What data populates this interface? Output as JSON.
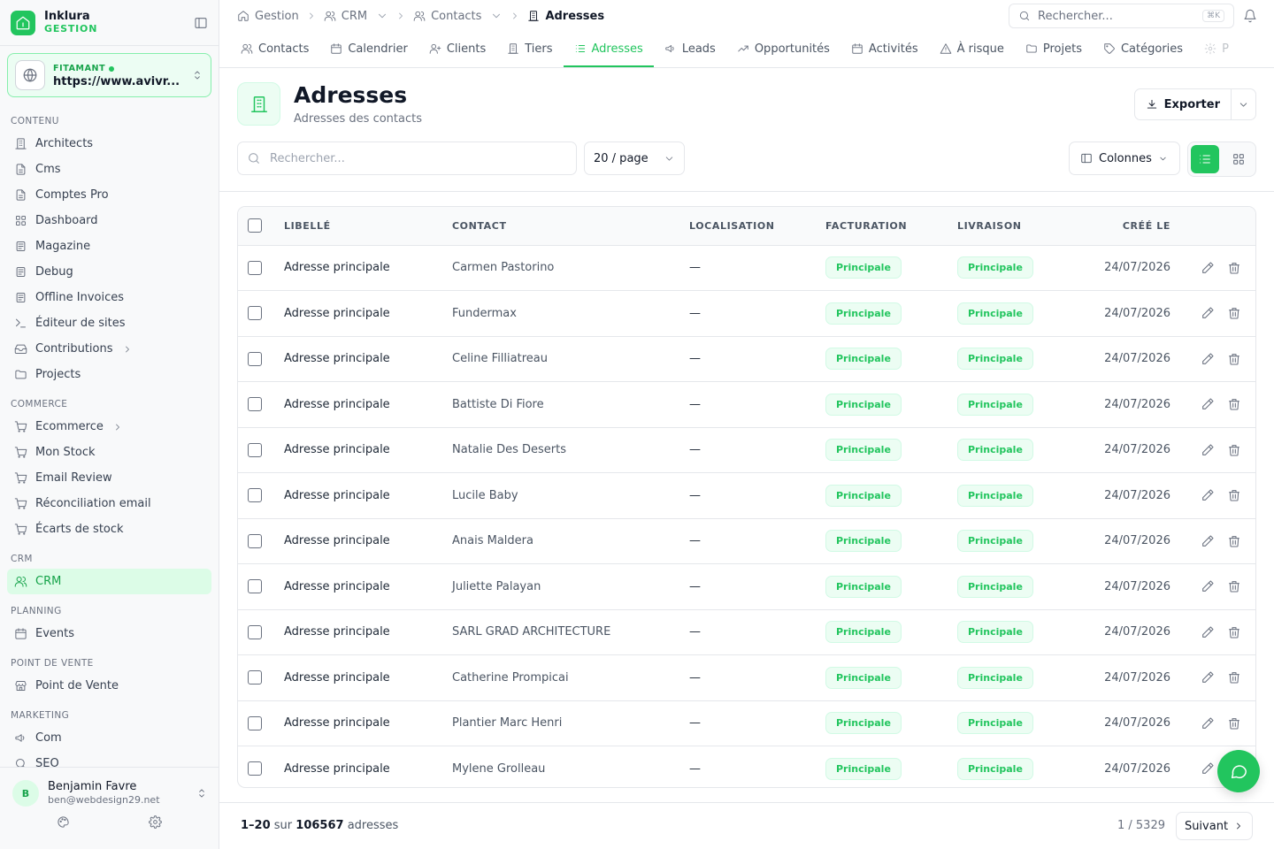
{
  "brand": {
    "name": "Inklura",
    "sub": "GESTION"
  },
  "site": {
    "label": "FITAMANT",
    "url": "https://www.avivr..."
  },
  "sidebar": {
    "sections": [
      {
        "title": "CONTENU",
        "items": [
          {
            "label": "Architects",
            "icon": "building-icon"
          },
          {
            "label": "Cms",
            "icon": "file-icon"
          },
          {
            "label": "Comptes Pro",
            "icon": "file-icon"
          },
          {
            "label": "Dashboard",
            "icon": "grid-icon"
          },
          {
            "label": "Magazine",
            "icon": "newspaper-icon"
          },
          {
            "label": "Debug",
            "icon": "newspaper-icon"
          },
          {
            "label": "Offline Invoices",
            "icon": "newspaper-icon"
          },
          {
            "label": "Éditeur de sites",
            "icon": "terminal-icon"
          },
          {
            "label": "Contributions",
            "icon": "inbox-icon",
            "chevron": true
          },
          {
            "label": "Projects",
            "icon": "folder-icon"
          }
        ]
      },
      {
        "title": "COMMERCE",
        "items": [
          {
            "label": "Ecommerce",
            "icon": "cart-icon",
            "chevron": true
          },
          {
            "label": "Mon Stock",
            "icon": "cart-icon"
          },
          {
            "label": "Email Review",
            "icon": "cart-icon"
          },
          {
            "label": "Réconciliation email",
            "icon": "cart-icon"
          },
          {
            "label": "Écarts de stock",
            "icon": "cart-icon"
          }
        ]
      },
      {
        "title": "CRM",
        "items": [
          {
            "label": "CRM",
            "icon": "users-icon",
            "active": true
          }
        ]
      },
      {
        "title": "PLANNING",
        "items": [
          {
            "label": "Events",
            "icon": "calendar-icon"
          }
        ]
      },
      {
        "title": "POINT DE VENTE",
        "items": [
          {
            "label": "Point de Vente",
            "icon": "store-icon"
          }
        ]
      },
      {
        "title": "MARKETING",
        "items": [
          {
            "label": "Com",
            "icon": "megaphone-icon"
          },
          {
            "label": "SEO",
            "icon": "search-icon"
          }
        ]
      }
    ]
  },
  "user": {
    "initial": "B",
    "name": "Benjamin Favre",
    "email": "ben@webdesign29.net"
  },
  "breadcrumb": [
    {
      "label": "Gestion",
      "icon": "home-icon"
    },
    {
      "label": "CRM",
      "icon": "users-icon",
      "dropdown": true
    },
    {
      "label": "Contacts",
      "icon": "users-icon",
      "dropdown": true
    },
    {
      "label": "Adresses",
      "icon": "building-icon",
      "current": true
    }
  ],
  "topsearch": {
    "placeholder": "Rechercher...",
    "shortcut": "⌘K"
  },
  "tabs": [
    {
      "label": "Contacts",
      "icon": "users-icon"
    },
    {
      "label": "Calendrier",
      "icon": "calendar-icon"
    },
    {
      "label": "Clients",
      "icon": "user-plus-icon"
    },
    {
      "label": "Tiers",
      "icon": "building-icon"
    },
    {
      "label": "Adresses",
      "icon": "list-icon",
      "active": true
    },
    {
      "label": "Leads",
      "icon": "megaphone-icon"
    },
    {
      "label": "Opportunités",
      "icon": "trend-icon"
    },
    {
      "label": "Activités",
      "icon": "calendar-icon"
    },
    {
      "label": "À risque",
      "icon": "alert-icon"
    },
    {
      "label": "Projets",
      "icon": "folder-icon"
    },
    {
      "label": "Catégories",
      "icon": "tag-icon"
    },
    {
      "label": "P",
      "icon": "gear-icon"
    }
  ],
  "page": {
    "title": "Adresses",
    "subtitle": "Adresses des contacts",
    "export_label": "Exporter"
  },
  "filters": {
    "search_placeholder": "Rechercher...",
    "per_page": "20 / page",
    "columns_label": "Colonnes"
  },
  "table": {
    "headers": {
      "libelle": "LIBELLÉ",
      "contact": "CONTACT",
      "localisation": "LOCALISATION",
      "facturation": "FACTURATION",
      "livraison": "LIVRAISON",
      "cree_le": "CRÉÉ LE"
    },
    "rows": [
      {
        "libelle": "Adresse principale",
        "contact": "Carmen Pastorino",
        "localisation": "—",
        "facturation": "Principale",
        "livraison": "Principale",
        "date": "24/07/2026"
      },
      {
        "libelle": "Adresse principale",
        "contact": "Fundermax",
        "localisation": "—",
        "facturation": "Principale",
        "livraison": "Principale",
        "date": "24/07/2026"
      },
      {
        "libelle": "Adresse principale",
        "contact": "Celine Filliatreau",
        "localisation": "—",
        "facturation": "Principale",
        "livraison": "Principale",
        "date": "24/07/2026"
      },
      {
        "libelle": "Adresse principale",
        "contact": "Battiste Di Fiore",
        "localisation": "—",
        "facturation": "Principale",
        "livraison": "Principale",
        "date": "24/07/2026"
      },
      {
        "libelle": "Adresse principale",
        "contact": "Natalie Des Deserts",
        "localisation": "—",
        "facturation": "Principale",
        "livraison": "Principale",
        "date": "24/07/2026"
      },
      {
        "libelle": "Adresse principale",
        "contact": "Lucile Baby",
        "localisation": "—",
        "facturation": "Principale",
        "livraison": "Principale",
        "date": "24/07/2026"
      },
      {
        "libelle": "Adresse principale",
        "contact": "Anais Maldera",
        "localisation": "—",
        "facturation": "Principale",
        "livraison": "Principale",
        "date": "24/07/2026"
      },
      {
        "libelle": "Adresse principale",
        "contact": "Juliette Palayan",
        "localisation": "—",
        "facturation": "Principale",
        "livraison": "Principale",
        "date": "24/07/2026"
      },
      {
        "libelle": "Adresse principale",
        "contact": "SARL GRAD ARCHITECTURE",
        "localisation": "—",
        "facturation": "Principale",
        "livraison": "Principale",
        "date": "24/07/2026"
      },
      {
        "libelle": "Adresse principale",
        "contact": "Catherine Prompicai",
        "localisation": "—",
        "facturation": "Principale",
        "livraison": "Principale",
        "date": "24/07/2026"
      },
      {
        "libelle": "Adresse principale",
        "contact": "Plantier Marc Henri",
        "localisation": "—",
        "facturation": "Principale",
        "livraison": "Principale",
        "date": "24/07/2026"
      },
      {
        "libelle": "Adresse principale",
        "contact": "Mylene Grolleau",
        "localisation": "—",
        "facturation": "Principale",
        "livraison": "Principale",
        "date": "24/07/2026"
      }
    ]
  },
  "footer": {
    "range": "1–20",
    "sur": "sur",
    "total": "106567",
    "unit": "adresses",
    "page_indicator": "1 / 5329",
    "next_label": "Suivant"
  },
  "colors": {
    "accent": "#22c55e",
    "accent_light": "#dcfce7",
    "border": "#e5e7eb"
  }
}
